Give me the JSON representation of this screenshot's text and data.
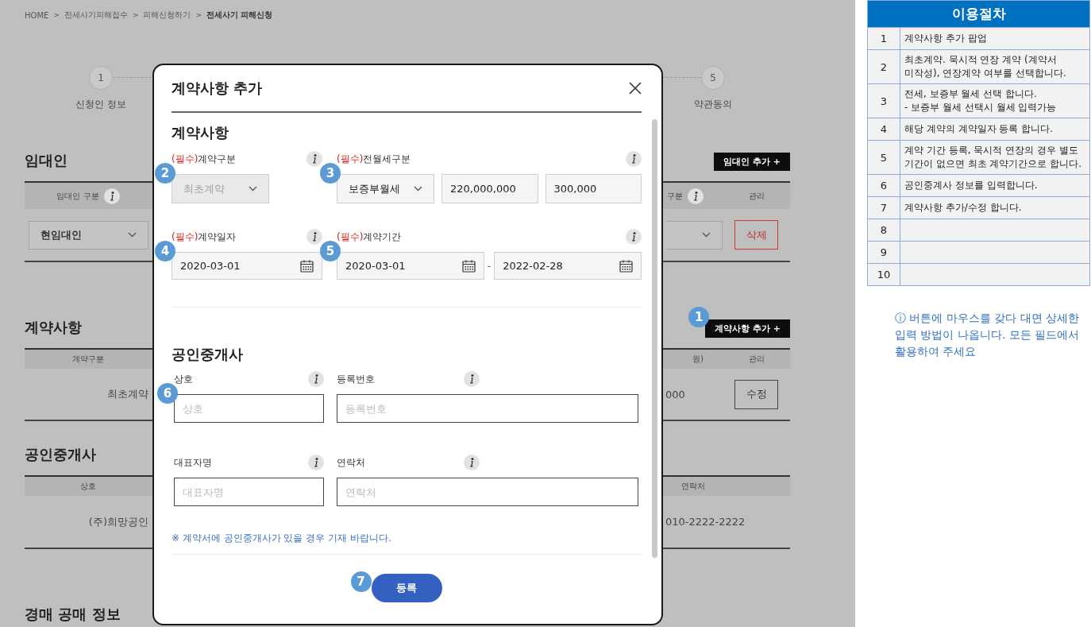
{
  "background": {
    "breadcrumb": [
      {
        "label": "HOME",
        "sep": ">",
        "current": false
      },
      {
        "label": "전세사기피해접수",
        "sep": ">",
        "current": false
      },
      {
        "label": "피해신청하기",
        "sep": ">",
        "current": false
      },
      {
        "label": "전세사기 피해신청",
        "current": true
      }
    ],
    "steps": [
      {
        "number": "1",
        "label": "신청인 정보"
      },
      {
        "number": "5",
        "label": "약관동의"
      }
    ],
    "sections": [
      {
        "title": "임대인",
        "action": {
          "label": "임대인 추가 +"
        },
        "header": {
          "left": {
            "text": "임대인 구분",
            "info": true
          },
          "right": [
            {
              "text": "구분",
              "info": true
            },
            {
              "text": "관리"
            }
          ]
        },
        "row": {
          "left": {
            "kind": "select",
            "text": "현임대인"
          },
          "right": [
            {
              "kind": "select"
            },
            {
              "kind": "danger-button",
              "text": "삭제"
            }
          ]
        }
      },
      {
        "title": "계약사항",
        "action": {
          "label": "계약사항 추가 +",
          "badge": "1"
        },
        "header": {
          "left": {
            "text": "계약구분"
          },
          "right": [
            {
              "text": "원)"
            },
            {
              "text": "관리"
            }
          ]
        },
        "row": {
          "left": {
            "kind": "text",
            "text": "최초계약"
          },
          "right": [
            {
              "kind": "text",
              "text": "000"
            },
            {
              "kind": "button",
              "text": "수정"
            }
          ]
        }
      },
      {
        "title": "공인중개사",
        "header": {
          "left": {
            "text": "상호"
          },
          "right": [
            {
              "text": "연락처"
            }
          ]
        },
        "row": {
          "left": {
            "kind": "text",
            "text": "(주)희망공인"
          },
          "right": [
            {
              "kind": "text",
              "text": "010-2222-2222"
            }
          ]
        }
      },
      {
        "title": "경매 공매 정보"
      }
    ]
  },
  "modal": {
    "title": "계약사항 추가",
    "contract": {
      "title": "계약사항",
      "fields": [
        {
          "required": "(필수)",
          "label": "계약구분",
          "badge": "2",
          "inputs": [
            {
              "kind": "select",
              "value": "최초계약",
              "disabled": true
            }
          ]
        },
        {
          "required": "(필수)",
          "label": "전월세구분",
          "badge": "3",
          "inputs": [
            {
              "kind": "select",
              "value": "보증부월세",
              "disabled": false
            },
            {
              "kind": "text",
              "value": "220,000,000"
            },
            {
              "kind": "text",
              "value": "300,000"
            }
          ]
        },
        {
          "required": "(필수)",
          "label": "계약일자",
          "badge": "4",
          "inputs": [
            {
              "kind": "date",
              "value": "2020-03-01"
            }
          ]
        },
        {
          "required": "(필수)",
          "label": "계약기간",
          "badge": "5",
          "inputs": [
            {
              "kind": "date",
              "value": "2020-03-01"
            },
            {
              "kind": "separator",
              "text": "-"
            },
            {
              "kind": "date",
              "value": "2022-02-28"
            }
          ]
        }
      ]
    },
    "broker": {
      "title": "공인중개사",
      "fields": [
        {
          "label": "상호",
          "placeholder": "상호",
          "badge": "6"
        },
        {
          "label": "등록번호",
          "placeholder": "등록번호"
        },
        {
          "label": "대표자명",
          "placeholder": "대표자명"
        },
        {
          "label": "연락처",
          "placeholder": "연락처"
        }
      ],
      "note": "※ 계약서에 공인중개사가 있을 경우 기재 바랍니다."
    },
    "submit": {
      "label": "등록",
      "badge": "7"
    }
  },
  "guide": {
    "title": "이용절차",
    "rows": [
      {
        "number": "1",
        "text": "계약사항 추가 팝업"
      },
      {
        "number": "2",
        "text": "최초계약. 묵시적 연장 계약 (계약서 미작성), 연장계약 여부를 선택합니다."
      },
      {
        "number": "3",
        "text": "전세, 보증부 월세 선택 합니다.\n- 보증부 월세 선택시 월세 입력가능"
      },
      {
        "number": "4",
        "text": "해당 계약의 계약일자 등록 합니다."
      },
      {
        "number": "5",
        "text": "계약 기간 등록, 묵시적 연장의 경우 별도 기간이 없으면 최초 계약기간으로 합니다."
      },
      {
        "number": "6",
        "text": "공인중계사 정보를 입력합니다."
      },
      {
        "number": "7",
        "text": "계약사항 추가/수정 합니다."
      },
      {
        "number": "8"
      },
      {
        "number": "9"
      },
      {
        "number": "10"
      }
    ],
    "note": "ⓘ 버튼에 마우스를 갖다 대면 상세한 입력 방법이 나옵니다. 모든 필드에서 활용하여 주세요"
  }
}
